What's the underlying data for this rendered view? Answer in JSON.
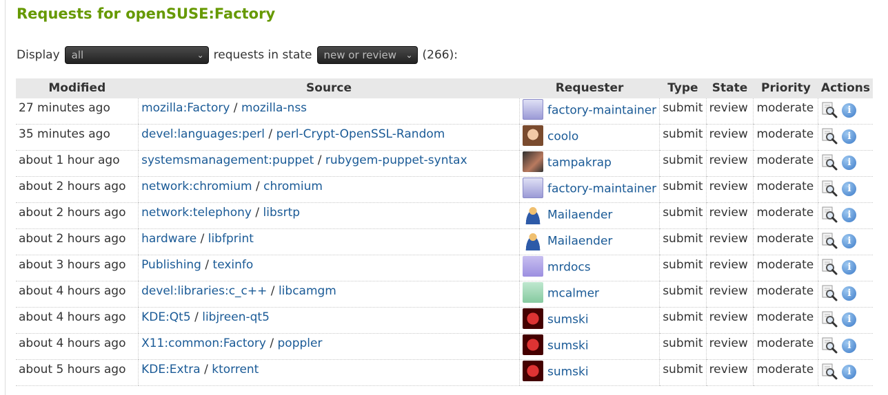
{
  "page": {
    "title": "Requests for openSUSE:Factory"
  },
  "filter": {
    "display_label": "Display",
    "display_value": "all",
    "state_label": "requests in state",
    "state_value": "new or review",
    "count": "(266):"
  },
  "table": {
    "headers": [
      "Modified",
      "Source",
      "Requester",
      "Type",
      "State",
      "Priority",
      "Actions"
    ],
    "rows": [
      {
        "modified": "27 minutes ago",
        "project": "mozilla:Factory",
        "package": "mozilla-nss",
        "requester": "factory-maintainer",
        "avatar": "factory",
        "type": "submit",
        "state": "review",
        "priority": "moderate"
      },
      {
        "modified": "35 minutes ago",
        "project": "devel:languages:perl",
        "package": "perl-Crypt-OpenSSL-Random",
        "requester": "coolo",
        "avatar": "coolo",
        "type": "submit",
        "state": "review",
        "priority": "moderate"
      },
      {
        "modified": "about 1 hour ago",
        "project": "systemsmanagement:puppet",
        "package": "rubygem-puppet-syntax",
        "requester": "tampakrap",
        "avatar": "tampa",
        "type": "submit",
        "state": "review",
        "priority": "moderate"
      },
      {
        "modified": "about 2 hours ago",
        "project": "network:chromium",
        "package": "chromium",
        "requester": "factory-maintainer",
        "avatar": "factory",
        "type": "submit",
        "state": "review",
        "priority": "moderate"
      },
      {
        "modified": "about 2 hours ago",
        "project": "network:telephony",
        "package": "libsrtp",
        "requester": "Mailaender",
        "avatar": "mail",
        "type": "submit",
        "state": "review",
        "priority": "moderate"
      },
      {
        "modified": "about 2 hours ago",
        "project": "hardware",
        "package": "libfprint",
        "requester": "Mailaender",
        "avatar": "mail",
        "type": "submit",
        "state": "review",
        "priority": "moderate"
      },
      {
        "modified": "about 3 hours ago",
        "project": "Publishing",
        "package": "texinfo",
        "requester": "mrdocs",
        "avatar": "mrdocs",
        "type": "submit",
        "state": "review",
        "priority": "moderate"
      },
      {
        "modified": "about 4 hours ago",
        "project": "devel:libraries:c_c++",
        "package": "libcamgm",
        "requester": "mcalmer",
        "avatar": "mcalmer",
        "type": "submit",
        "state": "review",
        "priority": "moderate"
      },
      {
        "modified": "about 4 hours ago",
        "project": "KDE:Qt5",
        "package": "libjreen-qt5",
        "requester": "sumski",
        "avatar": "sumski",
        "type": "submit",
        "state": "review",
        "priority": "moderate"
      },
      {
        "modified": "about 4 hours ago",
        "project": "X11:common:Factory",
        "package": "poppler",
        "requester": "sumski",
        "avatar": "sumski",
        "type": "submit",
        "state": "review",
        "priority": "moderate"
      },
      {
        "modified": "about 5 hours ago",
        "project": "KDE:Extra",
        "package": "ktorrent",
        "requester": "sumski",
        "avatar": "sumski",
        "type": "submit",
        "state": "review",
        "priority": "moderate"
      }
    ]
  },
  "icons": {
    "view": "magnifier-icon",
    "info": "info-icon",
    "chevron": "chevron-down-icon"
  },
  "colors": {
    "title": "#669900",
    "link": "#1a5a96",
    "header_bg": "#e8e8e8"
  }
}
